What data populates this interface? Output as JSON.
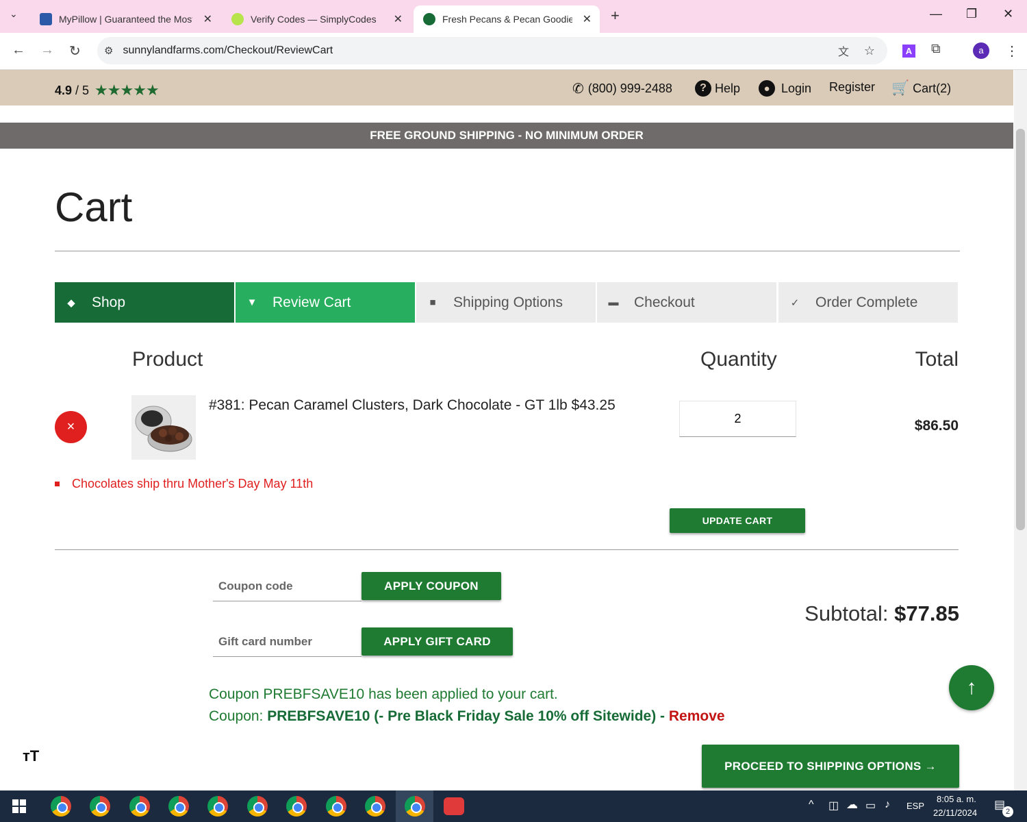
{
  "browser": {
    "tabs": [
      {
        "title": "MyPillow | Guaranteed the Most Comfortable Pillow"
      },
      {
        "title": "Verify Codes — SimplyCodes"
      },
      {
        "title": "Fresh Pecans & Pecan Goodies"
      }
    ],
    "new_tab": "+",
    "url": "sunnylandfarms.com/Checkout/ReviewCart",
    "profile_initial": "a"
  },
  "site": {
    "rating": "4.9",
    "rating_suffix": "/ 5",
    "stars": "★★★★★",
    "phone": "(800) 999-2488",
    "help": "Help",
    "login": "Login",
    "register": "Register",
    "cart": "Cart(2)",
    "banner": "FREE GROUND SHIPPING - NO MINIMUM ORDER"
  },
  "page": {
    "title": "Cart",
    "steps": [
      "Shop",
      "Review Cart",
      "Shipping Options",
      "Checkout",
      "Order Complete"
    ],
    "columns": {
      "product": "Product",
      "quantity": "Quantity",
      "total": "Total"
    },
    "item": {
      "name": "#381: Pecan Caramel Clusters, Dark Chocolate - GT 1lb $43.25",
      "quantity": "2",
      "total": "$86.50",
      "remove": "×"
    },
    "notice": "Chocolates ship thru Mother's Day May 11th",
    "update_cart": "UPDATE CART",
    "coupon_placeholder": "Coupon code",
    "apply_coupon": "APPLY COUPON",
    "gift_placeholder": "Gift card number",
    "apply_gift": "APPLY GIFT CARD",
    "subtotal_label": "Subtotal:",
    "subtotal_value": "$77.85",
    "coupon_message": "Coupon PREBFSAVE10 has been applied to your cart.",
    "coupon_prefix": "Coupon:",
    "coupon_detail": "PREBFSAVE10 (- Pre Black Friday Sale 10% off Sitewide) -",
    "coupon_remove": "Remove",
    "proceed": "PROCEED TO SHIPPING OPTIONS →",
    "to_top": "↑",
    "text_size": "ᴛT"
  },
  "taskbar": {
    "lang": "ESP",
    "time": "8:05 a. m.",
    "date": "22/11/2024",
    "notifications": "2"
  },
  "colors": {
    "dark_green": "#166b36",
    "green": "#27ae5e",
    "button_green": "#1f7a32",
    "red": "#e01f1f",
    "tan": "#d9cbb8"
  }
}
